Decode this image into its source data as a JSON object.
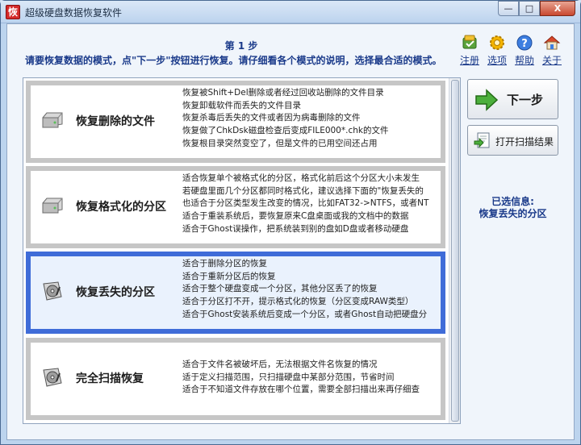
{
  "window": {
    "title": "超级硬盘数据恢复软件",
    "app_icon_glyph": "恢",
    "buttons": {
      "minimize": "—",
      "maximize": "□",
      "close": "X"
    }
  },
  "header": {
    "step": "第 1 步",
    "instruction": "请要恢复数据的模式，点\"下一步\"按钮进行恢复。请仔细看各个模式的说明，选择最合适的模式。"
  },
  "toolbar": [
    {
      "id": "register",
      "label": "注册",
      "icon": "register-icon"
    },
    {
      "id": "options",
      "label": "选项",
      "icon": "gear-icon"
    },
    {
      "id": "help",
      "label": "帮助",
      "icon": "help-icon"
    },
    {
      "id": "about",
      "label": "关于",
      "icon": "home-icon"
    }
  ],
  "modes": [
    {
      "name": "恢复删除的文件",
      "selected": false,
      "lines": [
        "恢复被Shift+Del删除或者经过回收站删除的文件目录",
        "恢复卸载软件而丢失的文件目录",
        "恢复杀毒后丢失的文件或者因为病毒删除的文件",
        "恢复做了ChkDsk磁盘检查后变成FILE000*.chk的文件",
        "恢复根目录突然变空了，但是文件的已用空间还占用"
      ]
    },
    {
      "name": "恢复格式化的分区",
      "selected": false,
      "lines": [
        "适合恢复单个被格式化的分区，格式化前后这个分区大小未发生",
        "若硬盘里面几个分区都同时格式化，建议选择下面的\"恢复丢失的",
        "也适合于分区类型发生改变的情况，比如FAT32->NTFS，或者NT",
        "适合于重装系统后，要恢复原来C盘桌面或我的文档中的数据",
        "适合于Ghost误操作，把系统装到别的盘如D盘或者移动硬盘"
      ]
    },
    {
      "name": "恢复丢失的分区",
      "selected": true,
      "lines": [
        "适合于删除分区的恢复",
        "适合于重新分区后的恢复",
        "适合于整个硬盘变成一个分区，其他分区丢了的恢复",
        "适合于分区打不开，提示格式化的恢复（分区变成RAW类型）",
        "适合于Ghost安装系统后变成一个分区，或者Ghost自动把硬盘分"
      ]
    },
    {
      "name": "完全扫描恢复",
      "selected": false,
      "lines": [
        "适合于文件名被破坏后，无法根据文件名恢复的情况",
        "适于定义扫描范围，只扫描硬盘中某部分范围，节省时间",
        "适合于不知道文件存放在哪个位置，需要全部扫描出来再仔细查"
      ]
    }
  ],
  "actions": {
    "next_label": "下一步",
    "open_scan_label": "打开扫描结果"
  },
  "info": {
    "label": "已选信息:",
    "value": "恢复丢失的分区"
  },
  "colors": {
    "selected_border": "#3f6cd8",
    "item_border": "#c6c6c6",
    "accent_text": "#1a3a8a"
  }
}
